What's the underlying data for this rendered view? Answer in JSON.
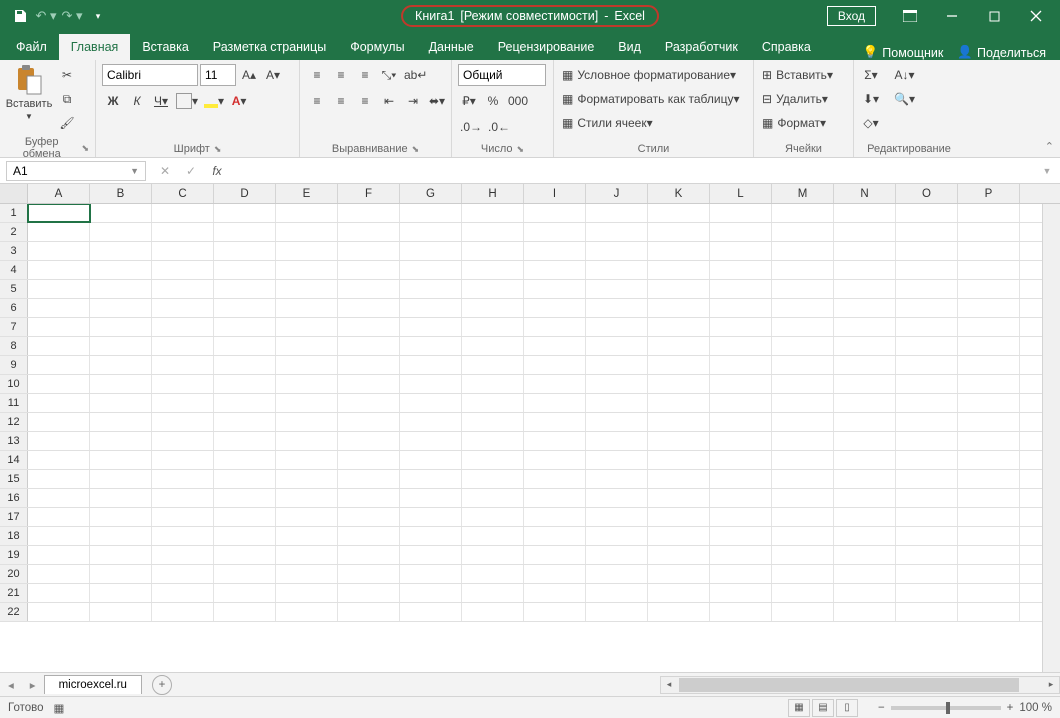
{
  "title": {
    "doc": "Книга1",
    "mode": "[Режим совместимости]",
    "app": "Excel",
    "login": "Вход"
  },
  "tabs": [
    "Файл",
    "Главная",
    "Вставка",
    "Разметка страницы",
    "Формулы",
    "Данные",
    "Рецензирование",
    "Вид",
    "Разработчик",
    "Справка"
  ],
  "tabs_active_index": 1,
  "tabs_right": {
    "tell": "Помощник",
    "share": "Поделиться"
  },
  "ribbon": {
    "clipboard": {
      "paste": "Вставить",
      "label": "Буфер обмена"
    },
    "font": {
      "name": "Calibri",
      "size": "11",
      "bold": "Ж",
      "italic": "К",
      "underline": "Ч",
      "label": "Шрифт"
    },
    "align": {
      "label": "Выравнивание"
    },
    "number": {
      "format": "Общий",
      "label": "Число"
    },
    "styles": {
      "cond": "Условное форматирование",
      "table": "Форматировать как таблицу",
      "cell": "Стили ячеек",
      "label": "Стили"
    },
    "cells": {
      "insert": "Вставить",
      "delete": "Удалить",
      "format": "Формат",
      "label": "Ячейки"
    },
    "editing": {
      "label": "Редактирование"
    }
  },
  "fbar": {
    "name": "A1",
    "fx": "fx"
  },
  "columns": [
    "A",
    "B",
    "C",
    "D",
    "E",
    "F",
    "G",
    "H",
    "I",
    "J",
    "K",
    "L",
    "M",
    "N",
    "O",
    "P"
  ],
  "rows": [
    1,
    2,
    3,
    4,
    5,
    6,
    7,
    8,
    9,
    10,
    11,
    12,
    13,
    14,
    15,
    16,
    17,
    18,
    19,
    20,
    21,
    22
  ],
  "sheet": {
    "name": "microexcel.ru"
  },
  "status": {
    "ready": "Готово",
    "zoom": "100 %"
  }
}
